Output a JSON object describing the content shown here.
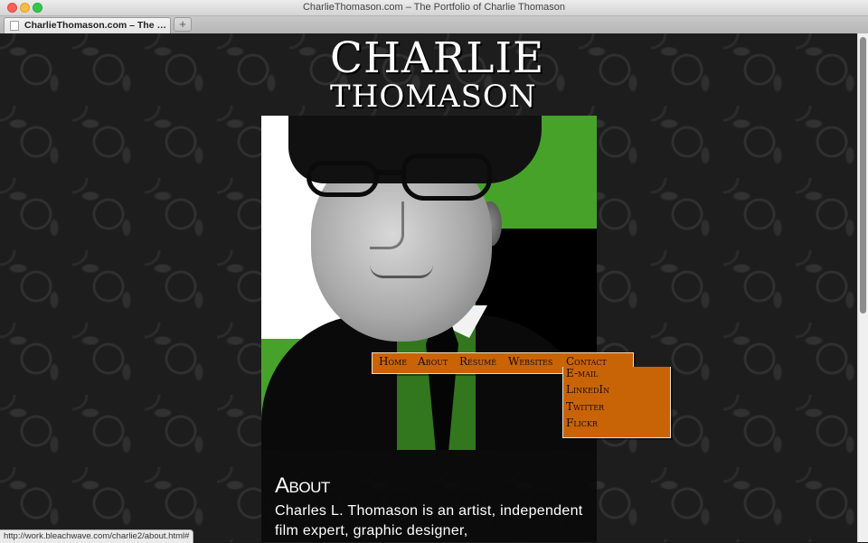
{
  "browser": {
    "window_title": "CharlieThomason.com – The Portfolio of Charlie Thomason",
    "tab_title": "CharlieThomason.com – The Po...",
    "new_tab_symbol": "+",
    "status_url": "http://work.bleachwave.com/charlie2/about.html#"
  },
  "logo": {
    "line1": "CHARLIE",
    "line2": "THOMASON"
  },
  "nav": {
    "items": [
      "Home",
      "About",
      "Résumé",
      "Websites",
      "Contact"
    ],
    "contact_submenu": [
      "E-mail",
      "LinkedIn",
      "Twitter",
      "Flickr"
    ]
  },
  "about": {
    "heading": "About",
    "body": "Charles L. Thomason is an artist, independent film expert, graphic designer,"
  },
  "colors": {
    "nav_background": "#c96406",
    "photo_green": "#47a229",
    "page_background": "#1d1d1d"
  }
}
